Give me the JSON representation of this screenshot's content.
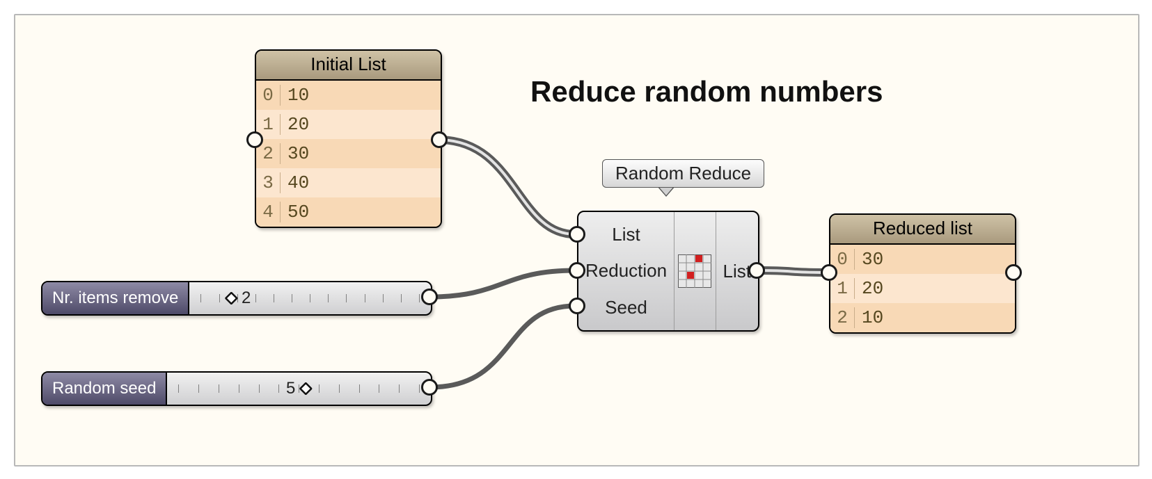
{
  "heading": "Reduce random numbers",
  "initial_list": {
    "title": "Initial List",
    "rows": [
      {
        "idx": "0",
        "val": "10"
      },
      {
        "idx": "1",
        "val": "20"
      },
      {
        "idx": "2",
        "val": "30"
      },
      {
        "idx": "3",
        "val": "40"
      },
      {
        "idx": "4",
        "val": "50"
      }
    ]
  },
  "reduced_list": {
    "title": "Reduced list",
    "rows": [
      {
        "idx": "0",
        "val": "30"
      },
      {
        "idx": "1",
        "val": "20"
      },
      {
        "idx": "2",
        "val": "10"
      }
    ]
  },
  "component": {
    "tooltip": "Random Reduce",
    "inputs": [
      "List",
      "Reduction",
      "Seed"
    ],
    "outputs": [
      "List"
    ]
  },
  "sliders": {
    "remove": {
      "label": "Nr. items remove",
      "value": "2",
      "fraction": 0.2
    },
    "seed": {
      "label": "Random seed",
      "value": "5",
      "fraction": 0.5
    }
  }
}
